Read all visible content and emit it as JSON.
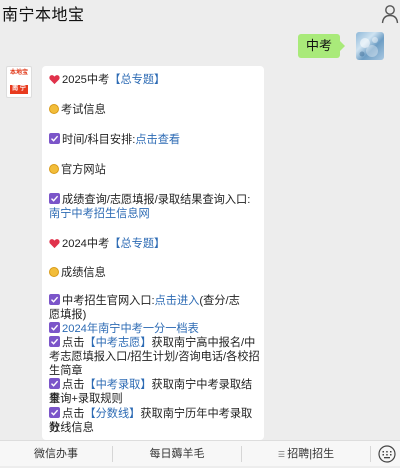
{
  "header": {
    "title": "南宁本地宝"
  },
  "messages": {
    "outgoing": {
      "text": "中考"
    }
  },
  "card": {
    "lines": [
      {
        "text": "2025中考",
        "link": "【总专题】"
      },
      {
        "text": "考试信息"
      },
      {
        "text": "时间/科目安排:",
        "link": "点击查看"
      },
      {
        "text": "官方网站"
      },
      {
        "text": "成绩查询/志愿填报/录取结果查询入口:"
      },
      {
        "text": "南宁中考招生信息网"
      },
      {
        "text": "2024中考",
        "link": "【总专题】"
      },
      {
        "text": "成绩信息"
      },
      {
        "text": "中考招生官网入口:",
        "link": "点击进入",
        "rest": "(查分/志"
      },
      {
        "text": "愿填报)"
      },
      {
        "link": "2024年南宁中考一分一档表"
      },
      {
        "text": "点击",
        "link": "【中考志愿】",
        "rest": "获取南宁高中报名/中"
      },
      {
        "text": "考志愿填报入口/招生计划/咨询电话/各校招"
      },
      {
        "text": "生简章"
      },
      {
        "text": "点击",
        "link": "【中考录取】",
        "rest": "获取南宁中考录取结果"
      },
      {
        "text": "查询+录取规则"
      },
      {
        "text": "点击",
        "link": "【分数线】",
        "rest": "获取南宁历年中考录取分"
      },
      {
        "text": "数线信息"
      }
    ]
  },
  "avatar": {
    "logo_top": "本地宝",
    "logo_bottom": "南 宁"
  },
  "bottom_menu": {
    "items": [
      "微信办事",
      "每日薅羊毛",
      "招聘|招生"
    ]
  },
  "icons": {
    "heart": "heart-icon",
    "circle": "yellow-circle-icon",
    "check": "checkbox-icon",
    "user": "user-icon",
    "keyboard": "keyboard-icon"
  },
  "colors": {
    "bubble_green": "#a9ea7a",
    "link_blue": "#2d6bb4",
    "check_purple": "#7b55c9",
    "heart_red": "#e0324b"
  }
}
